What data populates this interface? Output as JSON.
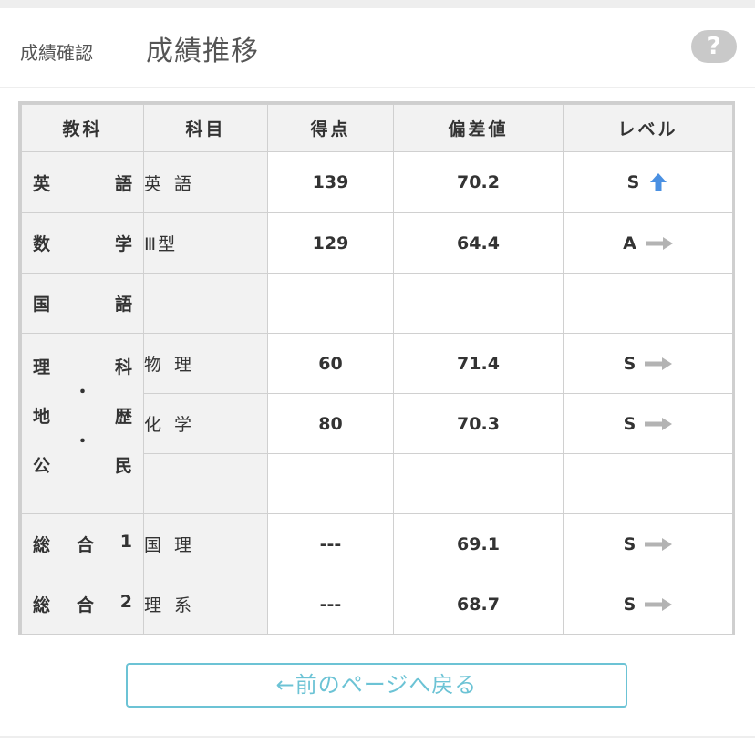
{
  "header": {
    "breadcrumb": "成績確認",
    "title": "成績推移",
    "help_label": "?"
  },
  "table": {
    "columns": [
      "教科",
      "科目",
      "得点",
      "偏差値",
      "レベル"
    ],
    "rows": [
      {
        "kyoka": [
          "英",
          "語"
        ],
        "kamoku": "英語",
        "score": "139",
        "hensachi": "70.2",
        "level": "S",
        "trend": "up"
      },
      {
        "kyoka": [
          "数",
          "学"
        ],
        "kamoku": "Ⅲ型",
        "score": "129",
        "hensachi": "64.4",
        "level": "A",
        "trend": "flat"
      },
      {
        "kyoka": [
          "国",
          "語"
        ],
        "kamoku": "",
        "score": "",
        "hensachi": "",
        "level": "",
        "trend": ""
      },
      {
        "kyoka_multi": [
          [
            "理",
            "科"
          ],
          [
            "地",
            "歴"
          ],
          [
            "公",
            "民"
          ]
        ],
        "kyoka_dot": "・",
        "kamoku": "物理",
        "score": "60",
        "hensachi": "71.4",
        "level": "S",
        "trend": "flat"
      },
      {
        "kamoku": "化学",
        "score": "80",
        "hensachi": "70.3",
        "level": "S",
        "trend": "flat"
      },
      {
        "kamoku": "",
        "score": "",
        "hensachi": "",
        "level": "",
        "trend": ""
      },
      {
        "kyoka": [
          "総",
          "合",
          "1"
        ],
        "kamoku": "国理",
        "score": "---",
        "hensachi": "69.1",
        "level": "S",
        "trend": "flat"
      },
      {
        "kyoka": [
          "総",
          "合",
          "2"
        ],
        "kamoku": "理系",
        "score": "---",
        "hensachi": "68.7",
        "level": "S",
        "trend": "flat"
      }
    ]
  },
  "back_button": "←前のページへ戻る",
  "colors": {
    "accent": "#6cc3d5",
    "arrow_up": "#4a90e2",
    "arrow_flat": "#b3b3b3",
    "cell_gray": "#f2f2f2"
  },
  "icons": {
    "up": "arrow-up-icon",
    "flat": "arrow-right-icon",
    "help": "question-icon"
  }
}
